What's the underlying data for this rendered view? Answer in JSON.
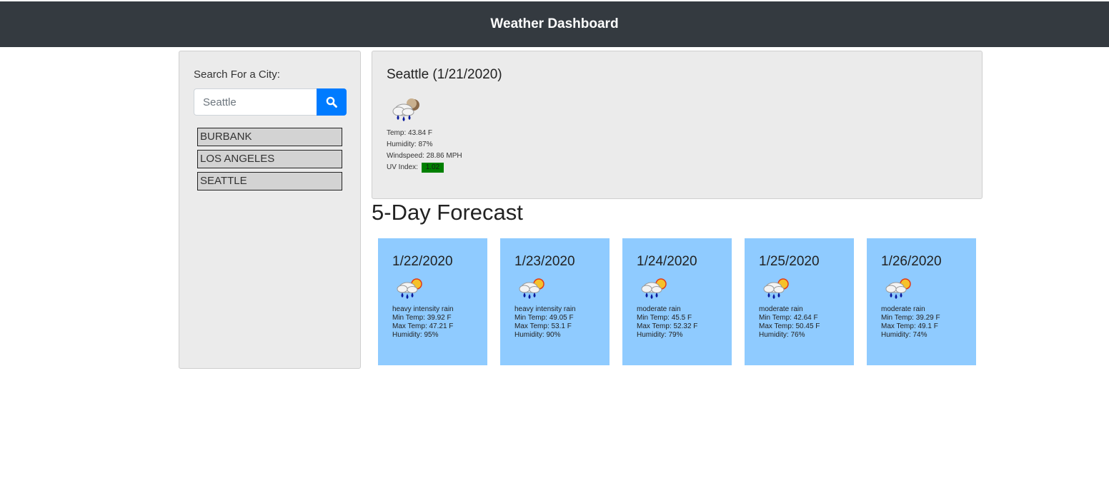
{
  "header": {
    "title": "Weather Dashboard"
  },
  "search": {
    "label": "Search For a City:",
    "placeholder": "Seattle",
    "button_icon": "search-icon"
  },
  "history": [
    {
      "label": "BURBANK"
    },
    {
      "label": "LOS ANGELES"
    },
    {
      "label": "SEATTLE"
    }
  ],
  "current": {
    "title": "Seattle (1/21/2020)",
    "icon": "rain-night-icon",
    "temp": "Temp: 43.84 F",
    "humidity": "Humidity: 87%",
    "windspeed": "Windspeed: 28.86 MPH",
    "uv_label": "UV Index:",
    "uv_value": "1.02",
    "uv_color": "#008000"
  },
  "forecast": {
    "heading": "5-Day Forecast",
    "card_color": "#8fcbff",
    "days": [
      {
        "date": "1/22/2020",
        "icon": "rain-sun-icon",
        "desc": "heavy intensity rain",
        "min": "Min Temp: 39.92 F",
        "max": "Max Temp: 47.21 F",
        "humidity": "Humidity: 95%"
      },
      {
        "date": "1/23/2020",
        "icon": "rain-sun-icon",
        "desc": "heavy intensity rain",
        "min": "Min Temp: 49.05 F",
        "max": "Max Temp: 53.1 F",
        "humidity": "Humidity: 90%"
      },
      {
        "date": "1/24/2020",
        "icon": "rain-sun-icon",
        "desc": "moderate rain",
        "min": "Min Temp: 45.5 F",
        "max": "Max Temp: 52.32 F",
        "humidity": "Humidity: 79%"
      },
      {
        "date": "1/25/2020",
        "icon": "rain-sun-icon",
        "desc": "moderate rain",
        "min": "Min Temp: 42.64 F",
        "max": "Max Temp: 50.45 F",
        "humidity": "Humidity: 76%"
      },
      {
        "date": "1/26/2020",
        "icon": "rain-sun-icon",
        "desc": "moderate rain",
        "min": "Min Temp: 39.29 F",
        "max": "Max Temp: 49.1 F",
        "humidity": "Humidity: 74%"
      }
    ]
  }
}
